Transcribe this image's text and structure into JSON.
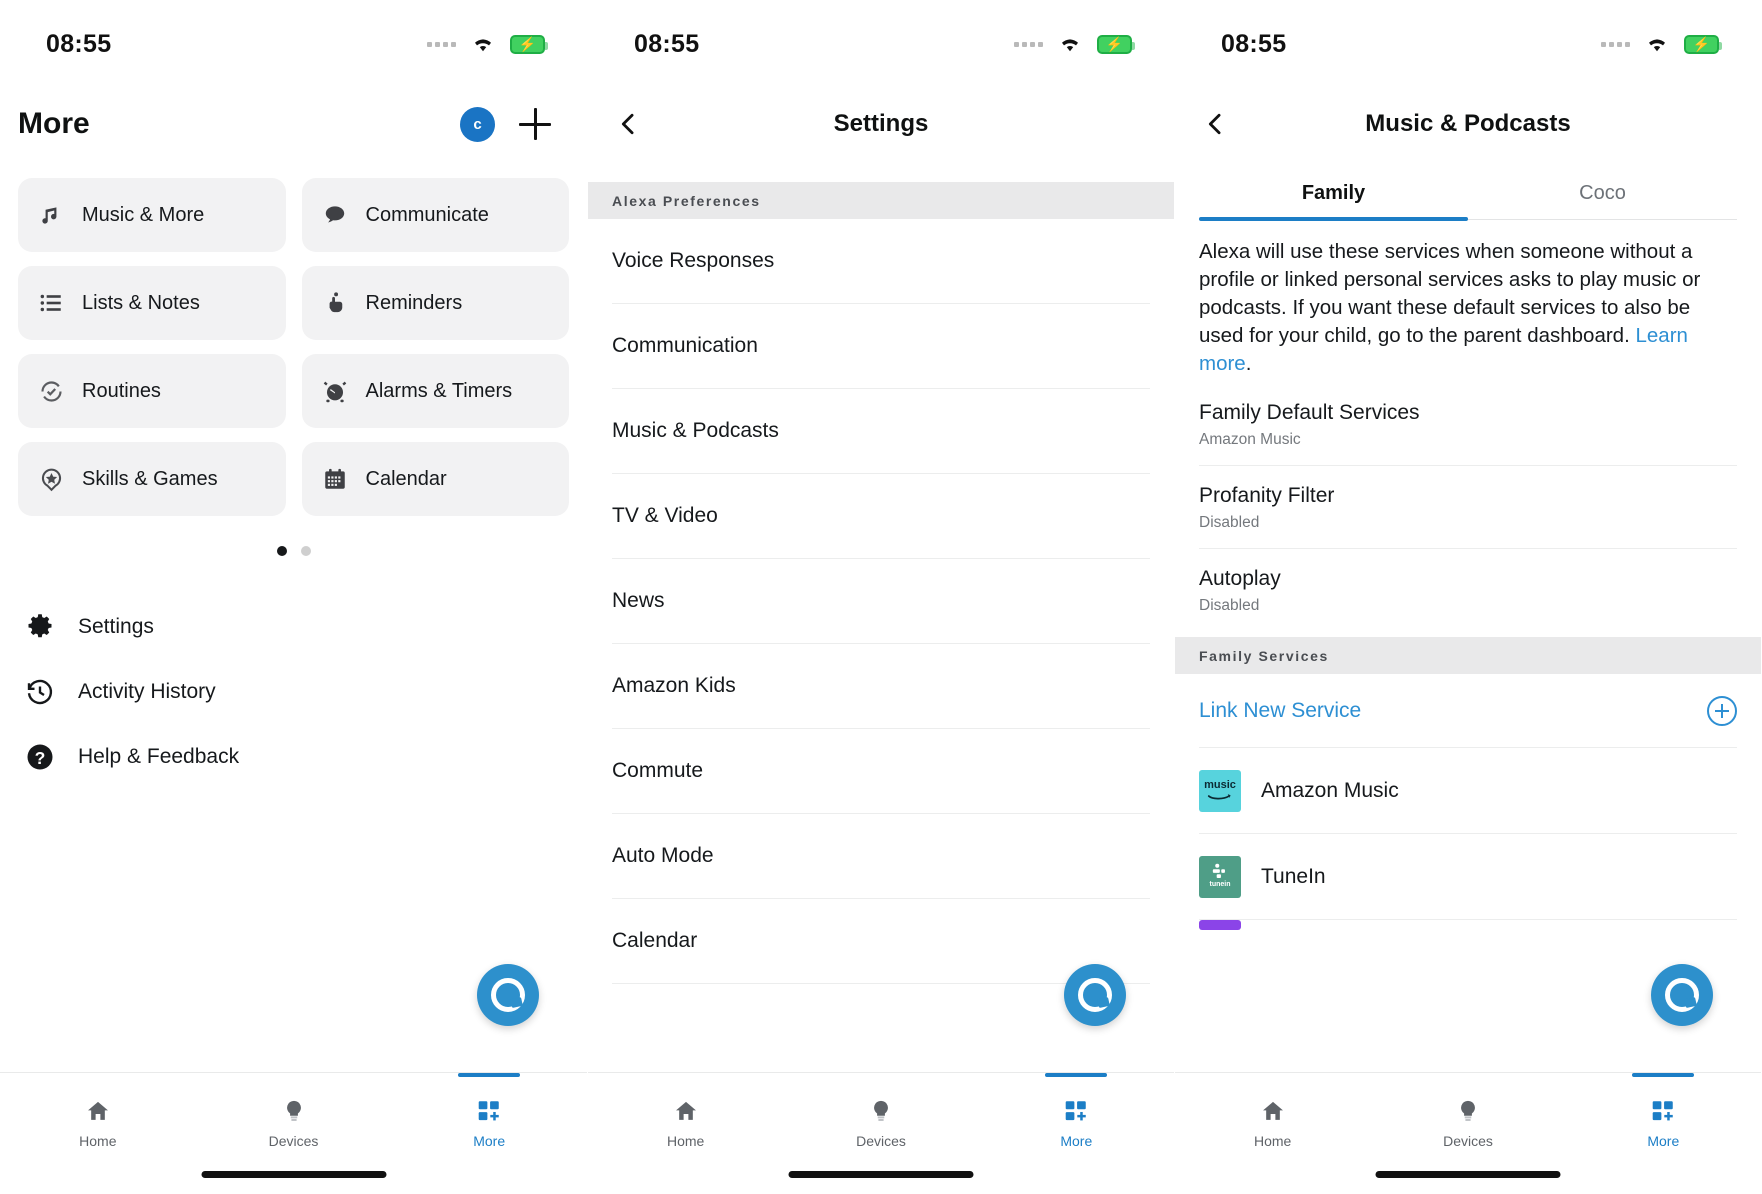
{
  "status_bar": {
    "time": "08:55",
    "wifi": "wifi-icon",
    "battery": "battery-charging-icon",
    "signal": "signal-dots-icon"
  },
  "colors": {
    "accent_blue": "#2d8fd3",
    "tab_blue": "#1c7ec6",
    "tile_bg": "#f2f2f3",
    "section_bg": "#e9e9ea",
    "amazon_music": "#57d3dd",
    "tunein": "#4f9e87",
    "partial_service": "#8b44e8"
  },
  "screen1": {
    "title": "More",
    "avatar_initial": "c",
    "add_button": "add-icon",
    "tiles": [
      {
        "label": "Music & More",
        "icon": "music-note-icon"
      },
      {
        "label": "Communicate",
        "icon": "speech-bubble-icon"
      },
      {
        "label": "Lists & Notes",
        "icon": "list-lines-icon"
      },
      {
        "label": "Reminders",
        "icon": "reminder-hand-icon"
      },
      {
        "label": "Routines",
        "icon": "routines-check-icon"
      },
      {
        "label": "Alarms & Timers",
        "icon": "alarm-clock-icon"
      },
      {
        "label": "Skills & Games",
        "icon": "skills-star-icon"
      },
      {
        "label": "Calendar",
        "icon": "calendar-icon"
      }
    ],
    "pager": {
      "pages": 2,
      "active_index": 0
    },
    "menu": [
      {
        "label": "Settings",
        "icon": "gear-icon"
      },
      {
        "label": "Activity History",
        "icon": "history-clock-icon"
      },
      {
        "label": "Help & Feedback",
        "icon": "question-mark-icon"
      }
    ]
  },
  "screen2": {
    "title": "Settings",
    "back": "back-chevron-icon",
    "section_header": "Alexa Preferences",
    "items": [
      "Voice Responses",
      "Communication",
      "Music & Podcasts",
      "TV & Video",
      "News",
      "Amazon Kids",
      "Commute",
      "Auto Mode",
      "Calendar"
    ]
  },
  "screen3": {
    "title": "Music & Podcasts",
    "back": "back-chevron-icon",
    "tabs": [
      {
        "label": "Family",
        "active": true
      },
      {
        "label": "Coco",
        "active": false
      }
    ],
    "blurb": "Alexa will use these services when someone without a profile or linked personal services asks to play music or podcasts. If you want these default services to also be used for your child, go to the parent dashboard. ",
    "blurb_link": "Learn more",
    "blurb_tail": ".",
    "settings": [
      {
        "title": "Family Default Services",
        "value": "Amazon Music"
      },
      {
        "title": "Profanity Filter",
        "value": "Disabled"
      },
      {
        "title": "Autoplay",
        "value": "Disabled"
      }
    ],
    "services_header": "Family Services",
    "link_new_service": "Link New Service",
    "link_new_service_icon": "plus-circle-icon",
    "services": [
      {
        "name": "Amazon Music",
        "logo_text": "music",
        "logo_color": "#57d3dd"
      },
      {
        "name": "TuneIn",
        "logo_text": "tunein",
        "logo_color": "#4f9e87"
      }
    ]
  },
  "fab": {
    "name": "alexa-button"
  },
  "bottom_nav": [
    {
      "label": "Home",
      "icon": "home-icon",
      "active": false
    },
    {
      "label": "Devices",
      "icon": "bulb-icon",
      "active": false
    },
    {
      "label": "More",
      "icon": "grid-plus-icon",
      "active": true
    }
  ]
}
